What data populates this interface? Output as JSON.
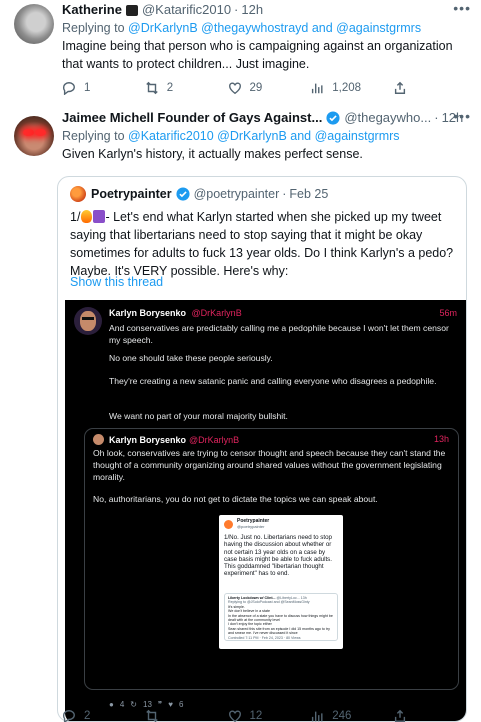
{
  "tweet1": {
    "name": "Katherine",
    "handle": "@Katarific2010",
    "time": "12h",
    "replying_prefix": "Replying to",
    "replying_to": "@DrKarlynB @thegaywhostrayd and @againstgrmrs",
    "text": "Imagine being that person who is campaigning against an organization that wants to protect children... Just imagine.",
    "stats": {
      "replies": "1",
      "retweets": "2",
      "likes": "29",
      "views": "1,208"
    }
  },
  "tweet2": {
    "name": "Jaimee Michell Founder of Gays Against...",
    "handle": "@thegaywho...",
    "time": "12h",
    "replying_prefix": "Replying to",
    "replying_to": "@Katarific2010 @DrKarlynB and @againstgrmrs",
    "text": "Given Karlyn's history, it actually makes perfect sense.",
    "stats": {
      "replies": "2",
      "retweets": "",
      "likes": "12",
      "views": "246"
    },
    "quote": {
      "name": "Poetrypainter",
      "handle": "@poetrypainter",
      "date": "Feb 25",
      "text_prefix": "1/",
      "text_dash": "- ",
      "text": "Let's end what Karlyn started when she picked up my tweet saying that libertarians need to stop saying that it might be okay sometimes for adults to fuck 13 year olds.  Do I think Karlyn's a pedo? Maybe.  It's VERY possible.  Here's why:",
      "show_thread": "Show this thread",
      "screenshot": {
        "name": "Karlyn Borysenko",
        "handle": "@DrKarlynB",
        "time": "56m",
        "paragraphs": [
          "And conservatives are predictably calling me a pedophile because I won't let them censor my speech.",
          "No one should take these people seriously.",
          "They're creating a new satanic panic and calling everyone who disagrees a pedophile.",
          "We want no part of your moral majority bullshit."
        ],
        "inner": {
          "name": "Karlyn Borysenko",
          "handle": "@DrKarlynB",
          "time": "13h",
          "paragraphs": [
            "Oh look, conservatives are trying to censor thought and speech because they can't stand the thought of a community organizing around shared values without the government legislating morality.",
            "No, authoritarians, you do not get to dictate the topics we can speak about."
          ],
          "mini": {
            "name": "Poetrypainter",
            "handle": "@poetrypainter",
            "text": "1/No.  Just no.  Libertarians need to stop having the discussion about whether or not certain 13 year olds on a case by case basis might be able to fuck adults.  This goddamned \"libertarian thought experiment\" has to end.",
            "card_name": "Liberty Lockdown w/ Clint...",
            "card_handle": "@LibertyLoc...",
            "card_time": "13h",
            "card_reply": "Replying to @JSoloPodcast and @SeanMossGinty",
            "card_lines": [
              "It's simple.",
              "We don't believe in a state",
              "In the absence of a state you have to discuss how things might be dealt with at the community level",
              "I don't enjoy the topic either",
              "Sean shared this site from an episode I did 15 months ago to try and smear me. I've never discussed it since"
            ],
            "card_stat": "Controlled 7:11 PM · Feb 24, 2023 · 80 Views"
          }
        },
        "actions": {
          "replies": "4",
          "retweets": "13",
          "quotes": "",
          "likes": "6"
        }
      }
    }
  }
}
